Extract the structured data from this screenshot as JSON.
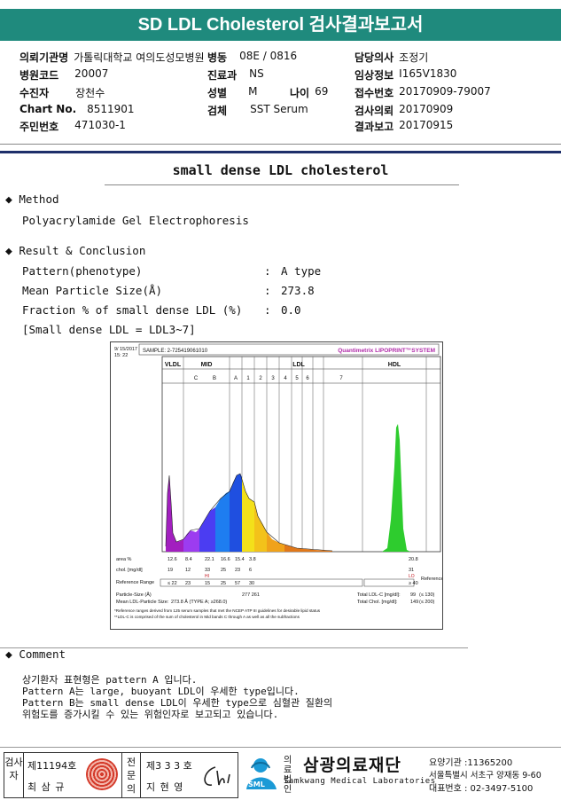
{
  "header": {
    "title": "SD LDL Cholesterol 검사결과보고서"
  },
  "info": {
    "hospital": {
      "k": "의뢰기관명",
      "v": "가톨릭대학교 여의도성모병원"
    },
    "ward": {
      "k": "병동",
      "v": "08E / 0816"
    },
    "doctor": {
      "k": "담당의사",
      "v": "조정기"
    },
    "code": {
      "k": "병원코드",
      "v": "20007"
    },
    "dept": {
      "k": "진료과",
      "v": "NS"
    },
    "clinical": {
      "k": "임상정보",
      "v": "I165V1830"
    },
    "patient": {
      "k": "수진자",
      "v": "장천수"
    },
    "sex": {
      "k": "성별",
      "v": "M"
    },
    "age": {
      "k": "나이",
      "v": "69"
    },
    "receipt": {
      "k": "접수번호",
      "v": "20170909-79007"
    },
    "chart": {
      "k": "Chart No.",
      "v": "8511901"
    },
    "specimen": {
      "k": "검체",
      "v": "SST Serum"
    },
    "request": {
      "k": "검사의뢰",
      "v": "20170909"
    },
    "id": {
      "k": "주민번호",
      "v": "471030-1"
    },
    "report": {
      "k": "결과보고",
      "v": "20170915"
    }
  },
  "report_title": "small dense LDL cholesterol",
  "method": {
    "heading": "Method",
    "text": "Polyacrylamide Gel Electrophoresis"
  },
  "result": {
    "heading": "Result & Conclusion",
    "rows": [
      {
        "label": "Pattern(phenotype)",
        "value": "A type"
      },
      {
        "label": "Mean Particle Size(Å)",
        "value": "273.8"
      },
      {
        "label": "Fraction % of small dense LDL (%)",
        "value": "0.0"
      }
    ],
    "note": "[Small dense LDL = LDL3~7]"
  },
  "chart_data": {
    "type": "area",
    "date": "9/ 15/2017",
    "time": "15: 22",
    "sample": "SAMPLE:  2-725419061010",
    "brand": "Quantimetrix LIPOPRINT™SYSTEM",
    "bands": [
      "VLDL",
      "MID",
      "LDL",
      "HDL"
    ],
    "subbands": [
      "C",
      "B",
      "A",
      "1",
      "2",
      "3",
      "4",
      "5",
      "6",
      "7"
    ],
    "area_label": "area %",
    "area": [
      "12.6",
      "8.4",
      "22.1",
      "16.6",
      "15.4",
      "3.8",
      "20.8"
    ],
    "chol_label": "chol. [mg/dl]",
    "chol": [
      "19",
      "12",
      "33",
      "25",
      "23",
      "6",
      "31"
    ],
    "hi": "HI",
    "lo": "LO",
    "ref_label": "Reference Range",
    "ref": [
      "≤ 22",
      "23",
      "15",
      "25",
      "57",
      "30",
      "≥ 40"
    ],
    "particle_size_label": "Particle-Size (Å)",
    "particle_size": "277  261",
    "mean_size_label": "Mean LDL-Particle Size:",
    "mean_size": "273.8 Å (TYPE A; ≥268.0)",
    "total_ldl_label": "Total LDL-C [mg/dl]:",
    "total_ldl": "99",
    "total_ldl_ref": "(≤ 130)",
    "total_chol_label": "Total Chol. [mg/dl]:",
    "total_chol": "149",
    "total_chol_ref": "(≤ 200)",
    "foot1": "*Reference ranges derived from 125 serum samples that met the NCEP ATP III guidelines for desirable lipid status",
    "foot2": "**LDL-C is comprised of the sum of cholesterol in Mid bands C through A as well as all the subfractions"
  },
  "comment": {
    "heading": "Comment",
    "lines": [
      "상기환자 표현형은 pattern A 입니다.",
      "Pattern A는 large, buoyant LDL이 우세한 type입니다.",
      "Pattern B는 small dense LDL이 우세한 type으로 심혈관 질환의",
      "위험도를 증가시킬 수 있는 위험인자로 보고되고 있습니다."
    ]
  },
  "footer": {
    "tester_title": "검사자",
    "tester_no": "제11194호",
    "tester_name": "최 삼 규",
    "specialist_title": "전문의",
    "specialist_no": "제3 3 3 호",
    "specialist_name": "지 현 영",
    "org_type": "의료법인",
    "org_name": "삼광의료재단",
    "org_en": "Samkwang Medical Laboratories",
    "sml": "SML",
    "org_code": "요양기관 :11365200",
    "address": "서울특별시 서초구 양재동 9-60",
    "phone": "대표번호 : 02-3497-5100"
  }
}
